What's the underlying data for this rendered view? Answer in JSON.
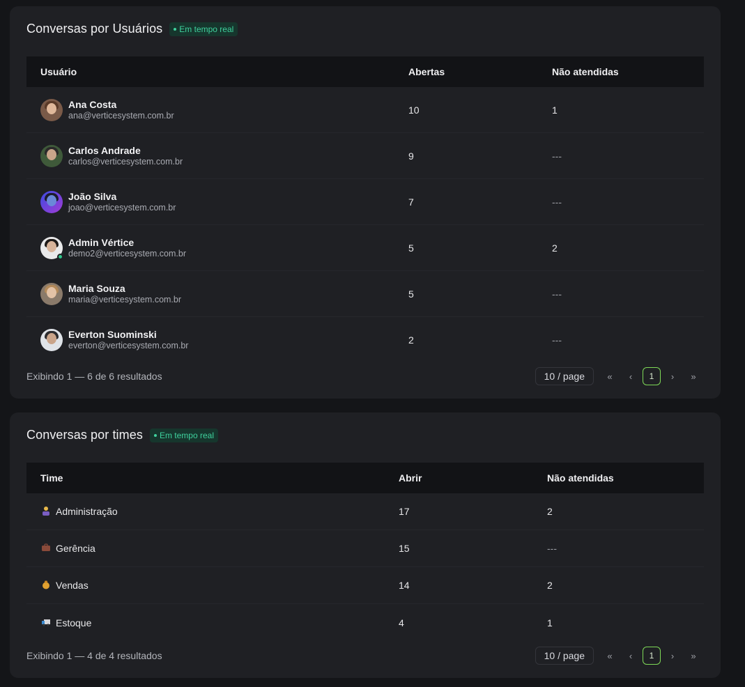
{
  "users_card": {
    "title": "Conversas por Usuários",
    "badge": "Em tempo real",
    "headers": {
      "user": "Usuário",
      "open": "Abertas",
      "unattended": "Não atendidas"
    },
    "rows": [
      {
        "name": "Ana Costa",
        "email": "ana@verticesystem.com.br",
        "open": "10",
        "unattended": "1"
      },
      {
        "name": "Carlos Andrade",
        "email": "carlos@verticesystem.com.br",
        "open": "9",
        "unattended": "---"
      },
      {
        "name": "João Silva",
        "email": "joao@verticesystem.com.br",
        "open": "7",
        "unattended": "---"
      },
      {
        "name": "Admin Vértice",
        "email": "demo2@verticesystem.com.br",
        "open": "5",
        "unattended": "2"
      },
      {
        "name": "Maria Souza",
        "email": "maria@verticesystem.com.br",
        "open": "5",
        "unattended": "---"
      },
      {
        "name": "Everton Suominski",
        "email": "everton@verticesystem.com.br",
        "open": "2",
        "unattended": "---"
      }
    ],
    "result_text": "Exibindo 1 — 6 de 6 resultados",
    "page_size": "10 / page",
    "current_page": "1"
  },
  "teams_card": {
    "title": "Conversas por times",
    "badge": "Em tempo real",
    "headers": {
      "team": "Time",
      "open": "Abrir",
      "unattended": "Não atendidas"
    },
    "rows": [
      {
        "icon": "person-icon",
        "name": "Administração",
        "open": "17",
        "unattended": "2"
      },
      {
        "icon": "briefcase-icon",
        "name": "Gerência",
        "open": "15",
        "unattended": "---"
      },
      {
        "icon": "money-bag-icon",
        "name": "Vendas",
        "open": "14",
        "unattended": "2"
      },
      {
        "icon": "truck-icon",
        "name": "Estoque",
        "open": "4",
        "unattended": "1"
      }
    ],
    "result_text": "Exibindo 1 — 4 de 4 resultados",
    "page_size": "10 / page",
    "current_page": "1"
  },
  "pager_glyphs": {
    "first": "«",
    "prev": "‹",
    "next": "›",
    "last": "»"
  },
  "colors": {
    "accent": "#7ed957",
    "badge_text": "#3fd19d",
    "online": "#2fc48a"
  }
}
